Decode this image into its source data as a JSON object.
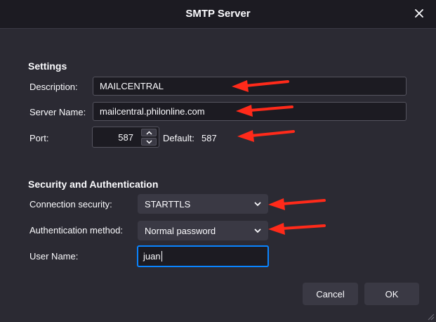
{
  "window": {
    "title": "SMTP Server"
  },
  "settings": {
    "heading": "Settings",
    "description_label": "Description:",
    "description_value": "MAILCENTRAL",
    "server_label": "Server Name:",
    "server_value": "mailcentral.philonline.com",
    "port_label": "Port:",
    "port_value": "587",
    "default_label": "Default:",
    "default_value": "587"
  },
  "security": {
    "heading": "Security and Authentication",
    "connection_label": "Connection security:",
    "connection_value": "STARTTLS",
    "auth_label": "Authentication method:",
    "auth_value": "Normal password",
    "username_label": "User Name:",
    "username_value": "juan"
  },
  "buttons": {
    "cancel": "Cancel",
    "ok": "OK"
  },
  "icons": {
    "close": "close-icon",
    "spin_up": "chevron-up-icon",
    "spin_down": "chevron-down-icon",
    "select": "chevron-down-icon",
    "annotation": "red-arrow-icon"
  },
  "colors": {
    "background": "#2b2a33",
    "titlebar": "#1c1b22",
    "field": "#1c1b22",
    "button": "#3a3944",
    "focus": "#0a84ff",
    "annotation": "#ff2a1a"
  }
}
